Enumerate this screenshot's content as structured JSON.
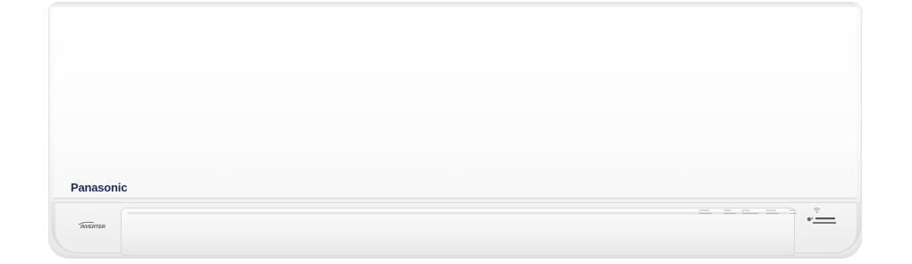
{
  "product": {
    "brand": "Panasonic",
    "inverter_badge": "INVERTER",
    "indicators": [
      "POWER",
      "TIMER",
      "QUIET",
      "NANOE",
      "ECO"
    ],
    "colors": {
      "body": "#f9f9f9",
      "brand_text": "#1f2d6b",
      "trim": "#d6d6d6"
    },
    "icons": {
      "wifi": "wifi-icon",
      "nanoe": "nanoe-badge-icon"
    }
  }
}
